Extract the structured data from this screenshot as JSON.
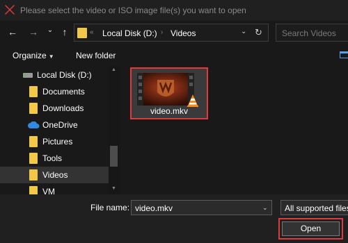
{
  "window": {
    "title": "Please select the video or ISO image file(s) you want to open",
    "app_icon": "red-x-icon"
  },
  "navigation": {
    "back": "←",
    "forward": "→",
    "recent": "⌄",
    "up": "↑",
    "breadcrumbs": [
      "Local Disk (D:)",
      "Videos"
    ],
    "overflow": "«",
    "separator": "›",
    "refresh": "↻",
    "dropdown": "⌄",
    "search_placeholder": "Search Videos"
  },
  "toolbar": {
    "organize_label": "Organize",
    "new_folder_label": "New folder"
  },
  "sidebar": {
    "items": [
      {
        "label": "Local Disk (D:)",
        "icon": "drive-icon"
      },
      {
        "label": "Documents",
        "icon": "folder-icon"
      },
      {
        "label": "Downloads",
        "icon": "folder-icon"
      },
      {
        "label": "OneDrive",
        "icon": "cloud-icon"
      },
      {
        "label": "Pictures",
        "icon": "folder-icon"
      },
      {
        "label": "Tools",
        "icon": "folder-icon"
      },
      {
        "label": "Videos",
        "icon": "folder-icon",
        "selected": true
      },
      {
        "label": "VM",
        "icon": "folder-icon"
      }
    ]
  },
  "files": [
    {
      "name": "video.mkv",
      "icon": "vlc-cone-icon",
      "selected": true
    }
  ],
  "footer": {
    "filename_label": "File name:",
    "filename_value": "video.mkv",
    "filter_value": "All supported files",
    "open_label": "Open"
  },
  "colors": {
    "highlight": "#e0393e",
    "folder": "#f2c84b",
    "onedrive": "#2f8ae0"
  }
}
